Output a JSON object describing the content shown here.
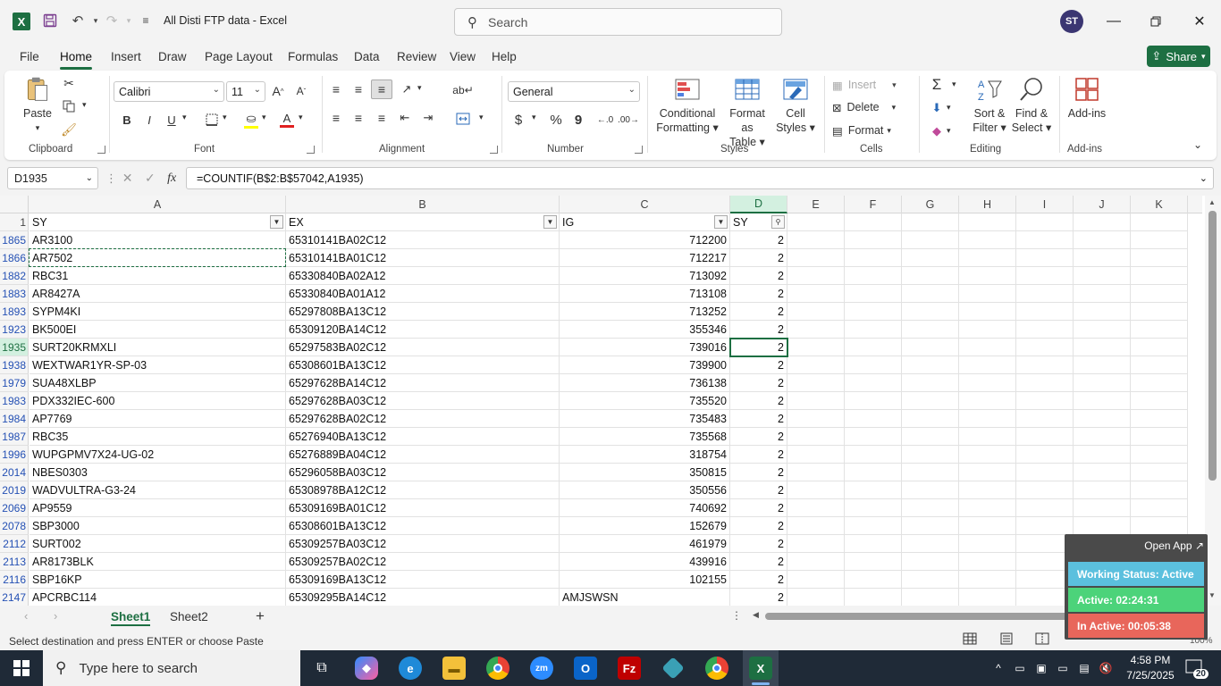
{
  "titlebar": {
    "app_initial": "X",
    "title": "All Disti FTP data  -  Excel",
    "search_placeholder": "Search",
    "avatar_initials": "ST"
  },
  "menu": {
    "tabs": [
      "File",
      "Home",
      "Insert",
      "Draw",
      "Page Layout",
      "Formulas",
      "Data",
      "Review",
      "View",
      "Help"
    ],
    "active": "Home",
    "share_label": "Share"
  },
  "ribbon": {
    "clipboard": {
      "paste": "Paste",
      "label": "Clipboard"
    },
    "font": {
      "name": "Calibri",
      "size": "11",
      "bold": "B",
      "italic": "I",
      "underline": "U",
      "label": "Font"
    },
    "alignment": {
      "label": "Alignment"
    },
    "number": {
      "format": "General",
      "currency": "$",
      "percent": "%",
      "comma": "9",
      "label": "Number"
    },
    "styles": {
      "conditional": "Conditional",
      "conditional2": "Formatting",
      "format_as": "Format as",
      "format_as2": "Table",
      "cell": "Cell",
      "cell2": "Styles",
      "label": "Styles"
    },
    "cells": {
      "insert": "Insert",
      "delete": "Delete",
      "format": "Format",
      "label": "Cells"
    },
    "editing": {
      "sort": "Sort &",
      "sort2": "Filter",
      "find": "Find &",
      "find2": "Select",
      "label": "Editing"
    },
    "addins": {
      "button": "Add-ins",
      "label": "Add-ins"
    }
  },
  "formula_bar": {
    "name_box": "D1935",
    "fx": "fx",
    "formula": "=COUNTIF(B$2:B$57042,A1935)"
  },
  "grid": {
    "columns": [
      "A",
      "B",
      "C",
      "D",
      "E",
      "F",
      "G",
      "H",
      "I",
      "J",
      "K"
    ],
    "header_row_number": "1",
    "headers": [
      "SY",
      "EX",
      "IG",
      "SY"
    ],
    "rows": [
      {
        "n": "1865",
        "a": "AR3100",
        "b": "65310141BA02C12",
        "c": "712200",
        "d": "2"
      },
      {
        "n": "1866",
        "a": "AR7502",
        "b": "65310141BA01C12",
        "c": "712217",
        "d": "2"
      },
      {
        "n": "1882",
        "a": "RBC31",
        "b": "65330840BA02A12",
        "c": "713092",
        "d": "2"
      },
      {
        "n": "1883",
        "a": "AR8427A",
        "b": "65330840BA01A12",
        "c": "713108",
        "d": "2"
      },
      {
        "n": "1893",
        "a": "SYPM4KI",
        "b": "65297808BA13C12",
        "c": "713252",
        "d": "2"
      },
      {
        "n": "1923",
        "a": "BK500EI",
        "b": "65309120BA14C12",
        "c": "355346",
        "d": "2"
      },
      {
        "n": "1935",
        "a": "SURT20KRMXLI",
        "b": "65297583BA02C12",
        "c": "739016",
        "d": "2"
      },
      {
        "n": "1938",
        "a": "WEXTWAR1YR-SP-03",
        "b": "65308601BA13C12",
        "c": "739900",
        "d": "2"
      },
      {
        "n": "1979",
        "a": "SUA48XLBP",
        "b": "65297628BA14C12",
        "c": "736138",
        "d": "2"
      },
      {
        "n": "1983",
        "a": "PDX332IEC-600",
        "b": "65297628BA03C12",
        "c": "735520",
        "d": "2"
      },
      {
        "n": "1984",
        "a": "AP7769",
        "b": "65297628BA02C12",
        "c": "735483",
        "d": "2"
      },
      {
        "n": "1987",
        "a": "RBC35",
        "b": "65276940BA13C12",
        "c": "735568",
        "d": "2"
      },
      {
        "n": "1996",
        "a": "WUPGPMV7X24-UG-02",
        "b": "65276889BA04C12",
        "c": "318754",
        "d": "2"
      },
      {
        "n": "2014",
        "a": "NBES0303",
        "b": "65296058BA03C12",
        "c": "350815",
        "d": "2"
      },
      {
        "n": "2019",
        "a": "WADVULTRA-G3-24",
        "b": "65308978BA12C12",
        "c": "350556",
        "d": "2"
      },
      {
        "n": "2069",
        "a": "AP9559",
        "b": "65309169BA01C12",
        "c": "740692",
        "d": "2"
      },
      {
        "n": "2078",
        "a": "SBP3000",
        "b": "65308601BA13C12",
        "c": "152679",
        "d": "2"
      },
      {
        "n": "2112",
        "a": "SURT002",
        "b": "65309257BA03C12",
        "c": "461979",
        "d": "2"
      },
      {
        "n": "2113",
        "a": "AR8173BLK",
        "b": "65309257BA02C12",
        "c": "439916",
        "d": "2"
      },
      {
        "n": "2116",
        "a": "SBP16KP",
        "b": "65309169BA13C12",
        "c": "102155",
        "d": "2"
      },
      {
        "n": "2147",
        "a": "APCRBC114",
        "b": "65309295BA14C12",
        "c": "AMJSWSN",
        "d": "2"
      }
    ]
  },
  "sheets": {
    "tabs": [
      "Sheet1",
      "Sheet2"
    ],
    "active": "Sheet1",
    "add": "+"
  },
  "status": {
    "message": "Select destination and press ENTER or choose Paste",
    "zoom": "100%"
  },
  "overlay": {
    "open_app": "Open App",
    "working_status": "Working Status: Active",
    "active_time": "Active: 02:24:31",
    "inactive_time": "In Active: 00:05:38",
    "colors": {
      "status": "#5bc0de",
      "active": "#4cd37a",
      "inactive": "#e8665b"
    }
  },
  "taskbar": {
    "search_placeholder": "Type here to search",
    "time": "4:58 PM",
    "date": "7/25/2025",
    "notifications": "20"
  },
  "colors": {
    "accent": "#1d6f42",
    "taskbar": "#1f2a37"
  }
}
